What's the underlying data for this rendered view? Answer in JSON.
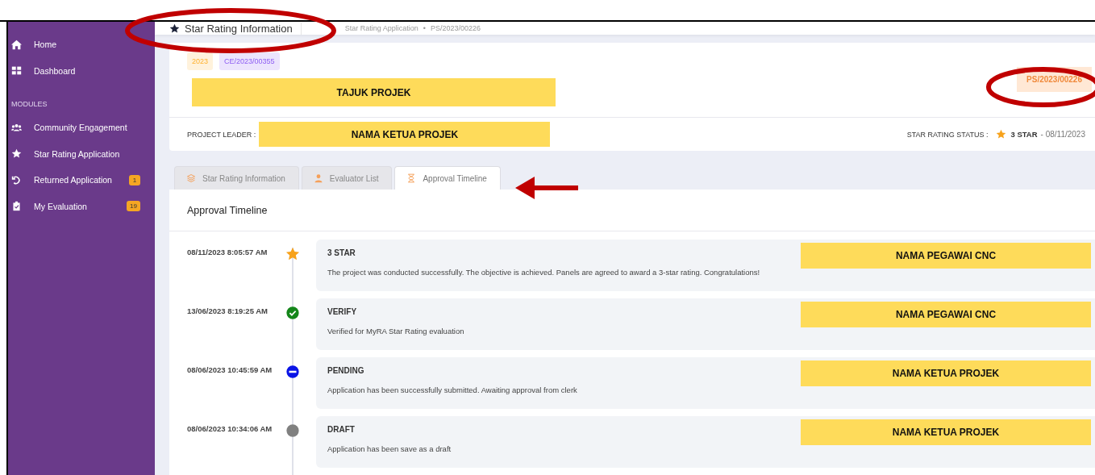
{
  "sidebar": {
    "items": [
      {
        "label": "Home",
        "kind": "home"
      },
      {
        "label": "Dashboard",
        "kind": "grid"
      }
    ],
    "section_title": "MODULES",
    "modules": [
      {
        "label": "Community Engagement",
        "kind": "users"
      },
      {
        "label": "Star Rating Application",
        "kind": "star"
      },
      {
        "label": "Returned Application",
        "kind": "undo",
        "badge": "1"
      },
      {
        "label": "My Evaluation",
        "kind": "clipboard",
        "badge": "19"
      }
    ]
  },
  "header": {
    "title": "Star Rating Information",
    "breadcrumb": [
      "Star Rating Application",
      "PS/2023/00226"
    ],
    "separator": "•"
  },
  "project": {
    "tags": [
      {
        "text": "2023",
        "color": "#fff2dc"
      },
      {
        "text": "CE/2023/00355",
        "color": "#ece4fd"
      }
    ],
    "title": "TAJUK PROJEK",
    "reference": "PS/2023/00226",
    "leader_label": "PROJECT LEADER :",
    "leader": "NAMA KETUA PROJEK",
    "status_label": "STAR RATING STATUS :",
    "status": "3 STAR",
    "status_date": "- 08/11/2023"
  },
  "tabs": [
    {
      "label": "Star Rating Information",
      "kind": "layers",
      "selected": false
    },
    {
      "label": "Evaluator List",
      "kind": "person",
      "selected": false
    },
    {
      "label": "Approval Timeline",
      "kind": "hourglass",
      "selected": true
    }
  ],
  "timeline": {
    "heading": "Approval Timeline",
    "items": [
      {
        "time": "08/11/2023 8:05:57 AM",
        "kind": "star",
        "title": "3 STAR",
        "text": "The project was conducted successfully. The objective is achieved. Panels are agreed to award a 3-star rating. Congratulations!",
        "officer": "NAMA PEGAWAI CNC"
      },
      {
        "time": "13/06/2023 8:19:25 AM",
        "kind": "verify",
        "title": "VERIFY",
        "text": "Verified for MyRA Star Rating evaluation",
        "officer": "NAMA PEGAWAI CNC"
      },
      {
        "time": "08/06/2023 10:45:59 AM",
        "kind": "pending",
        "title": "PENDING",
        "text": "Application has been successfully submitted. Awaiting approval from clerk",
        "officer": "NAMA KETUA PROJEK"
      },
      {
        "time": "08/06/2023 10:34:06 AM",
        "kind": "draft",
        "title": "DRAFT",
        "text": "Application has been save as a draft",
        "officer": "NAMA KETUA PROJEK"
      }
    ]
  }
}
